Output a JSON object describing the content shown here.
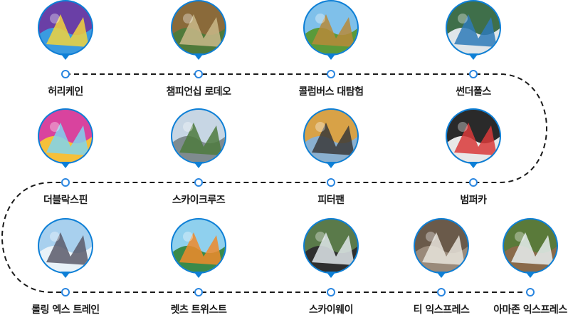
{
  "rows": [
    {
      "rides": [
        {
          "id": "hurricane",
          "name": "허리케인",
          "colors": [
            "#6a3fa6",
            "#f2d43c",
            "#3a9be0"
          ]
        },
        {
          "id": "champion-rodeo",
          "name": "챔피언십 로데오",
          "colors": [
            "#8a6a3a",
            "#c9b88a",
            "#4f7a3a"
          ]
        },
        {
          "id": "columbus",
          "name": "콜럼버스 대탐험",
          "colors": [
            "#7fc0ea",
            "#b78a3a",
            "#5a9a3a"
          ]
        },
        {
          "id": "thunder-falls",
          "name": "썬더폴스",
          "colors": [
            "#3f6f4a",
            "#2e7ab8",
            "#e0e6ea"
          ]
        }
      ]
    },
    {
      "rides": [
        {
          "id": "double-spin",
          "name": "더블락스핀",
          "colors": [
            "#d9439e",
            "#7fd3ee",
            "#f5c03a"
          ]
        },
        {
          "id": "sky-cruise",
          "name": "스카이크루즈",
          "colors": [
            "#c7d6e4",
            "#4d7a3e",
            "#7f8b8f"
          ]
        },
        {
          "id": "peter-pan",
          "name": "피터팬",
          "colors": [
            "#d8a247",
            "#3a3a3a",
            "#8ab0d0"
          ]
        },
        {
          "id": "bumper-car",
          "name": "범퍼카",
          "colors": [
            "#2a2a2a",
            "#d93a3a",
            "#e8e8e8"
          ]
        }
      ]
    },
    {
      "rides": [
        {
          "id": "rolling-x-train",
          "name": "롤링 엑스 트레인",
          "colors": [
            "#a8d0ee",
            "#5a5a6a",
            "#e9f2f8"
          ]
        },
        {
          "id": "lets-twist",
          "name": "렛츠 트위스트",
          "colors": [
            "#8fd0ee",
            "#f08a2a",
            "#3a8a4a"
          ]
        },
        {
          "id": "sky-way",
          "name": "스카이웨이",
          "colors": [
            "#5a7a4a",
            "#dfe6ea",
            "#2f2f2f"
          ]
        },
        {
          "id": "t-express",
          "name": "티 익스프레스",
          "colors": [
            "#6a5a4a",
            "#e8e4dc",
            "#9a8a7a"
          ]
        },
        {
          "id": "amazon-express",
          "name": "아마존 익스프레스",
          "colors": [
            "#5a7a3a",
            "#e8eef0",
            "#8a6a4a"
          ]
        }
      ]
    }
  ]
}
